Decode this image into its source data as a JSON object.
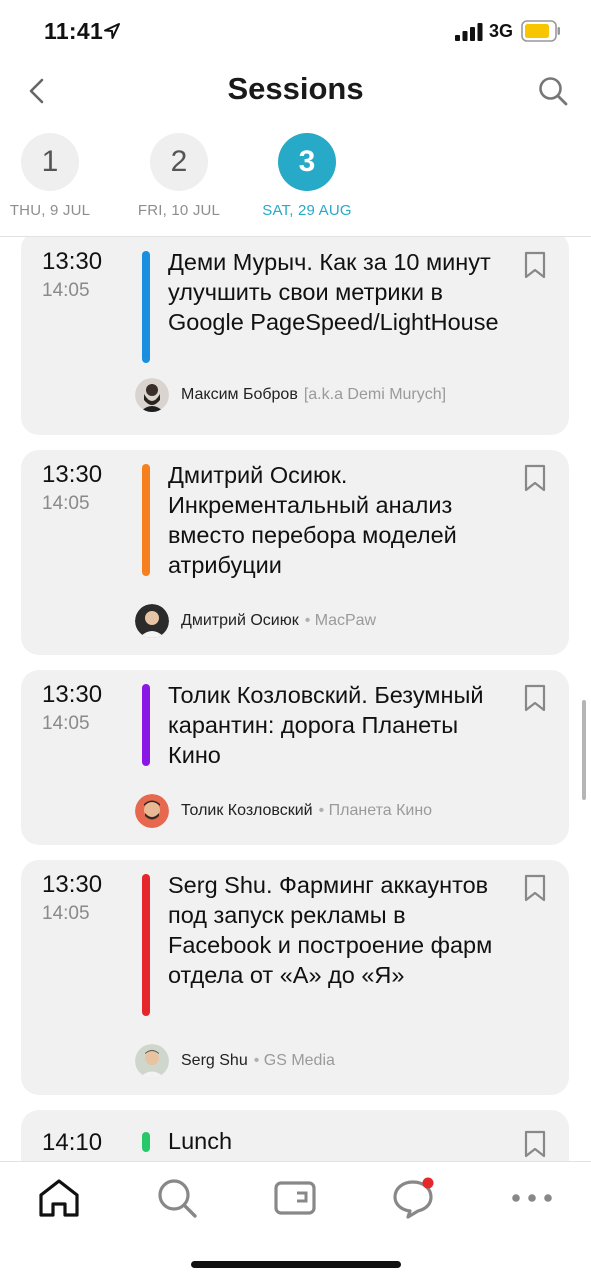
{
  "status_bar": {
    "time": "11:41",
    "network": "3G"
  },
  "nav": {
    "title": "Sessions"
  },
  "days": [
    {
      "number": "1",
      "label": "THU, 9 JUL",
      "active": false
    },
    {
      "number": "2",
      "label": "FRI, 10 JUL",
      "active": false
    },
    {
      "number": "3",
      "label": "SAT, 29 AUG",
      "active": true
    }
  ],
  "sessions": [
    {
      "start": "13:30",
      "end": "14:05",
      "color": "#1a8fe0",
      "title": "Деми Мурыч. Как за 10 минут улучшить свои метрики в Google PageSpeed/LightHouse",
      "speaker": "Максим Бобров",
      "company": "[a.k.a Demi Murych]"
    },
    {
      "start": "13:30",
      "end": "14:05",
      "color": "#f6801e",
      "title": "Дмитрий Осиюк. Инкрементальный анализ вместо перебора моделей атрибуции",
      "speaker": "Дмитрий  Осиюк",
      "company": "MacPaw"
    },
    {
      "start": "13:30",
      "end": "14:05",
      "color": "#8b17e6",
      "title": "Толик Козловский. Безумный карантин: дорога Планеты Кино",
      "speaker": "Толик Козловский",
      "company": "Планета Кино"
    },
    {
      "start": "13:30",
      "end": "14:05",
      "color": "#e5262b",
      "title": "Serg Shu. Фарминг аккаунтов под запуск рекламы в Facebook и построение фарм отдела от «А» до «Я»",
      "speaker": "Serg Shu",
      "company": "GS Media"
    },
    {
      "start": "14:10",
      "end": "",
      "color": "#27c86a",
      "title": "Lunch",
      "speaker": "",
      "company": ""
    }
  ],
  "tabs": [
    {
      "name": "home",
      "icon": "home-icon",
      "active": true
    },
    {
      "name": "search",
      "icon": "search-icon",
      "active": false
    },
    {
      "name": "wallet",
      "icon": "wallet-icon",
      "active": false
    },
    {
      "name": "chat",
      "icon": "chat-icon",
      "active": false,
      "badge": true
    },
    {
      "name": "more",
      "icon": "more-icon",
      "active": false
    }
  ],
  "colors": {
    "accent": "#27a9c8",
    "badge": "#e5262b"
  }
}
